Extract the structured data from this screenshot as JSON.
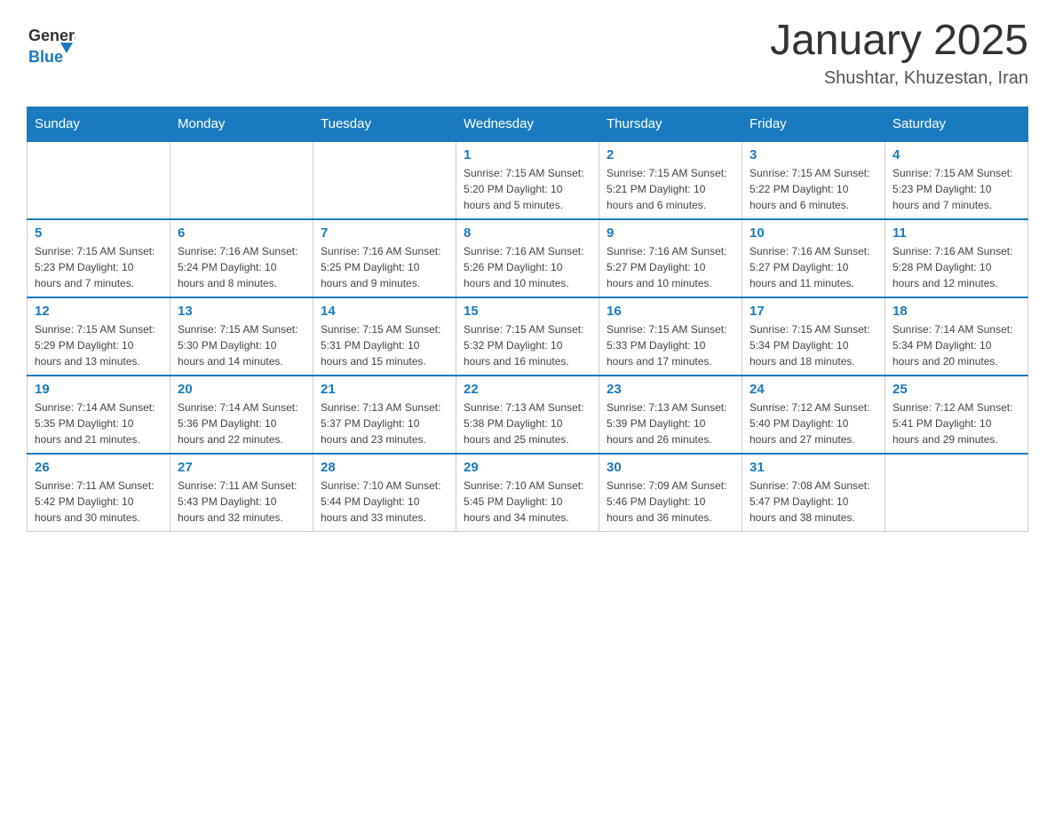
{
  "header": {
    "logo_general": "General",
    "logo_blue": "Blue",
    "month_title": "January 2025",
    "subtitle": "Shushtar, Khuzestan, Iran"
  },
  "calendar": {
    "days_of_week": [
      "Sunday",
      "Monday",
      "Tuesday",
      "Wednesday",
      "Thursday",
      "Friday",
      "Saturday"
    ],
    "weeks": [
      [
        {
          "day": "",
          "info": ""
        },
        {
          "day": "",
          "info": ""
        },
        {
          "day": "",
          "info": ""
        },
        {
          "day": "1",
          "info": "Sunrise: 7:15 AM\nSunset: 5:20 PM\nDaylight: 10 hours and 5 minutes."
        },
        {
          "day": "2",
          "info": "Sunrise: 7:15 AM\nSunset: 5:21 PM\nDaylight: 10 hours and 6 minutes."
        },
        {
          "day": "3",
          "info": "Sunrise: 7:15 AM\nSunset: 5:22 PM\nDaylight: 10 hours and 6 minutes."
        },
        {
          "day": "4",
          "info": "Sunrise: 7:15 AM\nSunset: 5:23 PM\nDaylight: 10 hours and 7 minutes."
        }
      ],
      [
        {
          "day": "5",
          "info": "Sunrise: 7:15 AM\nSunset: 5:23 PM\nDaylight: 10 hours and 7 minutes."
        },
        {
          "day": "6",
          "info": "Sunrise: 7:16 AM\nSunset: 5:24 PM\nDaylight: 10 hours and 8 minutes."
        },
        {
          "day": "7",
          "info": "Sunrise: 7:16 AM\nSunset: 5:25 PM\nDaylight: 10 hours and 9 minutes."
        },
        {
          "day": "8",
          "info": "Sunrise: 7:16 AM\nSunset: 5:26 PM\nDaylight: 10 hours and 10 minutes."
        },
        {
          "day": "9",
          "info": "Sunrise: 7:16 AM\nSunset: 5:27 PM\nDaylight: 10 hours and 10 minutes."
        },
        {
          "day": "10",
          "info": "Sunrise: 7:16 AM\nSunset: 5:27 PM\nDaylight: 10 hours and 11 minutes."
        },
        {
          "day": "11",
          "info": "Sunrise: 7:16 AM\nSunset: 5:28 PM\nDaylight: 10 hours and 12 minutes."
        }
      ],
      [
        {
          "day": "12",
          "info": "Sunrise: 7:15 AM\nSunset: 5:29 PM\nDaylight: 10 hours and 13 minutes."
        },
        {
          "day": "13",
          "info": "Sunrise: 7:15 AM\nSunset: 5:30 PM\nDaylight: 10 hours and 14 minutes."
        },
        {
          "day": "14",
          "info": "Sunrise: 7:15 AM\nSunset: 5:31 PM\nDaylight: 10 hours and 15 minutes."
        },
        {
          "day": "15",
          "info": "Sunrise: 7:15 AM\nSunset: 5:32 PM\nDaylight: 10 hours and 16 minutes."
        },
        {
          "day": "16",
          "info": "Sunrise: 7:15 AM\nSunset: 5:33 PM\nDaylight: 10 hours and 17 minutes."
        },
        {
          "day": "17",
          "info": "Sunrise: 7:15 AM\nSunset: 5:34 PM\nDaylight: 10 hours and 18 minutes."
        },
        {
          "day": "18",
          "info": "Sunrise: 7:14 AM\nSunset: 5:34 PM\nDaylight: 10 hours and 20 minutes."
        }
      ],
      [
        {
          "day": "19",
          "info": "Sunrise: 7:14 AM\nSunset: 5:35 PM\nDaylight: 10 hours and 21 minutes."
        },
        {
          "day": "20",
          "info": "Sunrise: 7:14 AM\nSunset: 5:36 PM\nDaylight: 10 hours and 22 minutes."
        },
        {
          "day": "21",
          "info": "Sunrise: 7:13 AM\nSunset: 5:37 PM\nDaylight: 10 hours and 23 minutes."
        },
        {
          "day": "22",
          "info": "Sunrise: 7:13 AM\nSunset: 5:38 PM\nDaylight: 10 hours and 25 minutes."
        },
        {
          "day": "23",
          "info": "Sunrise: 7:13 AM\nSunset: 5:39 PM\nDaylight: 10 hours and 26 minutes."
        },
        {
          "day": "24",
          "info": "Sunrise: 7:12 AM\nSunset: 5:40 PM\nDaylight: 10 hours and 27 minutes."
        },
        {
          "day": "25",
          "info": "Sunrise: 7:12 AM\nSunset: 5:41 PM\nDaylight: 10 hours and 29 minutes."
        }
      ],
      [
        {
          "day": "26",
          "info": "Sunrise: 7:11 AM\nSunset: 5:42 PM\nDaylight: 10 hours and 30 minutes."
        },
        {
          "day": "27",
          "info": "Sunrise: 7:11 AM\nSunset: 5:43 PM\nDaylight: 10 hours and 32 minutes."
        },
        {
          "day": "28",
          "info": "Sunrise: 7:10 AM\nSunset: 5:44 PM\nDaylight: 10 hours and 33 minutes."
        },
        {
          "day": "29",
          "info": "Sunrise: 7:10 AM\nSunset: 5:45 PM\nDaylight: 10 hours and 34 minutes."
        },
        {
          "day": "30",
          "info": "Sunrise: 7:09 AM\nSunset: 5:46 PM\nDaylight: 10 hours and 36 minutes."
        },
        {
          "day": "31",
          "info": "Sunrise: 7:08 AM\nSunset: 5:47 PM\nDaylight: 10 hours and 38 minutes."
        },
        {
          "day": "",
          "info": ""
        }
      ]
    ]
  }
}
